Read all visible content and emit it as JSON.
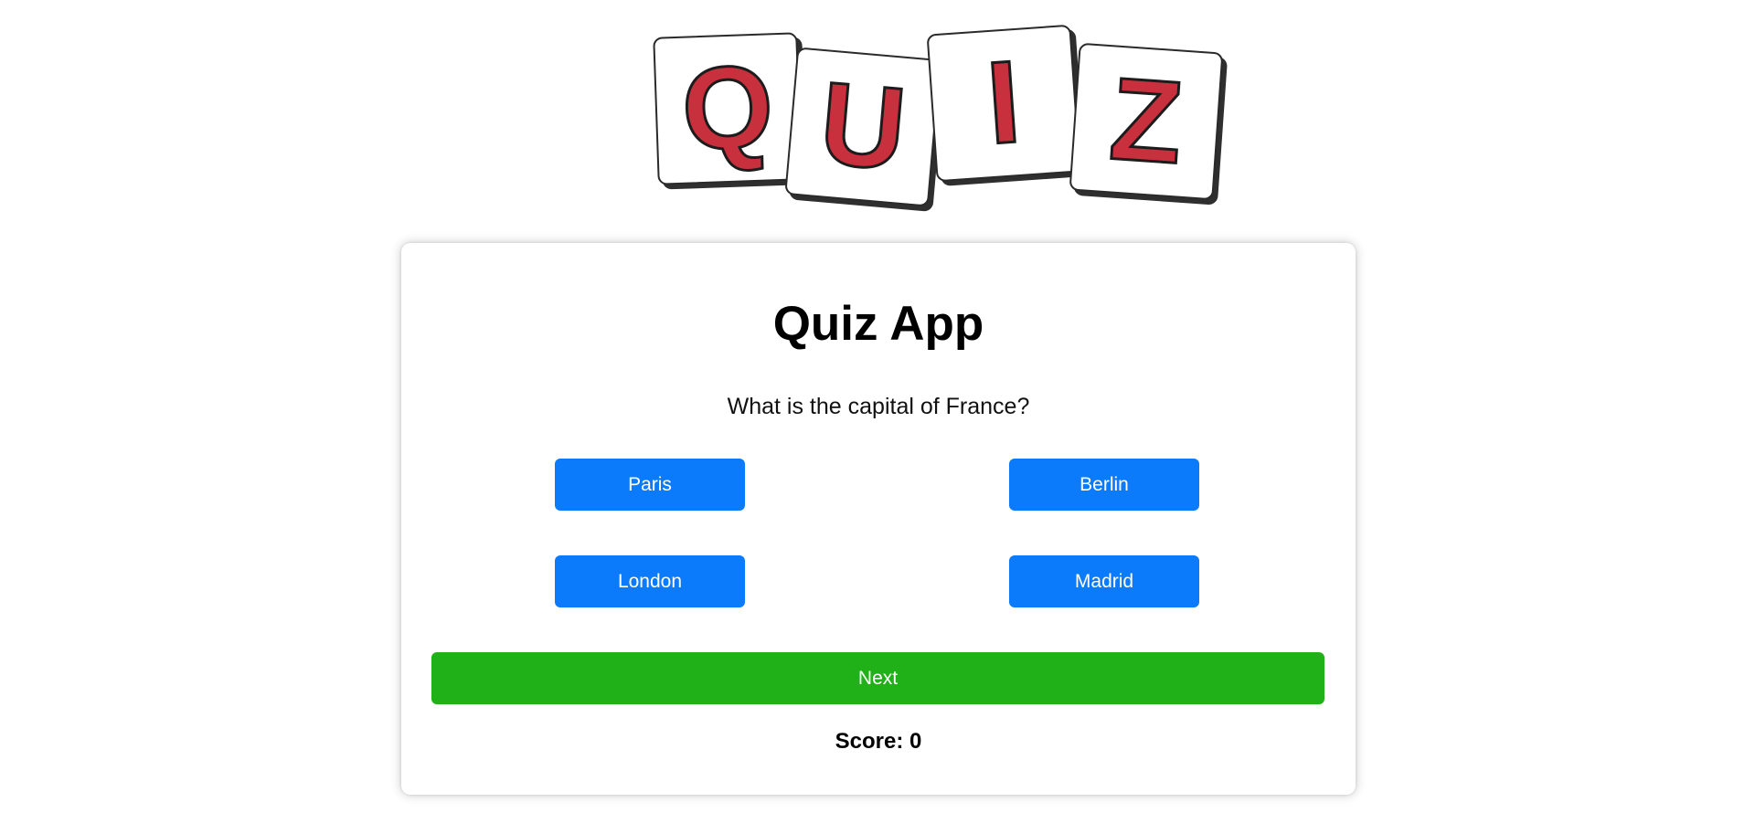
{
  "logo": {
    "letters": [
      "Q",
      "U",
      "I",
      "Z"
    ]
  },
  "quiz": {
    "title": "Quiz App",
    "question": "What is the capital of France?",
    "answers": [
      "Paris",
      "Berlin",
      "London",
      "Madrid"
    ],
    "next_label": "Next",
    "score_label": "Score: 0"
  },
  "colors": {
    "answer_button": "#0c7bfb",
    "next_button": "#20b018",
    "logo_letter": "#c7303c"
  }
}
